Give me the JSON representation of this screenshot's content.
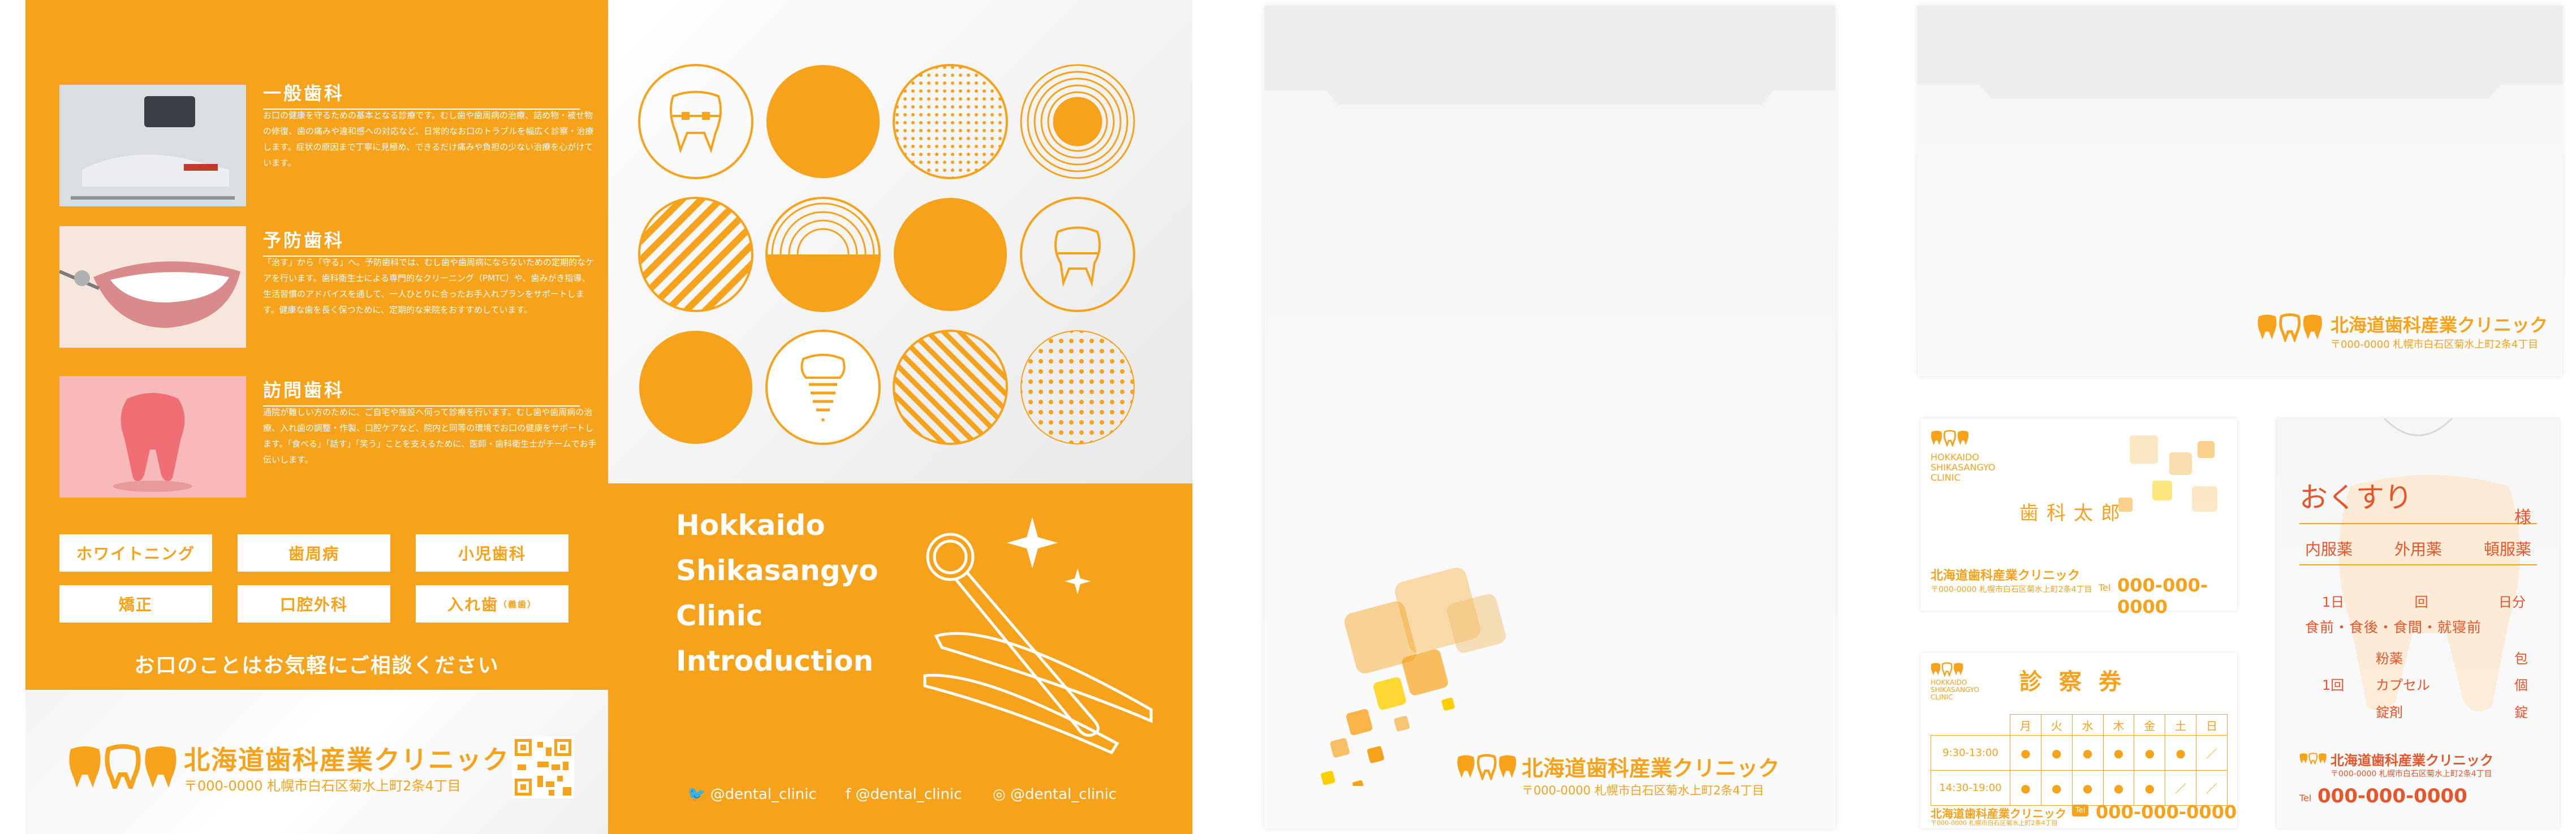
{
  "clinic": {
    "name_jp": "北海道歯科産業クリニック",
    "address": "〒000-0000 札幌市白石区菊水上町2条4丁目",
    "tel_label": "Tel",
    "tel": "000-000-0000"
  },
  "services": [
    {
      "title": "一般歯科",
      "text": "お口の健康を守るための基本となる診療です。むし歯や歯周病の治療、詰め物・被せ物の修復、歯の痛みや違和感への対応など、日常的なお口のトラブルを幅広く診察・治療します。症状の原因まで丁寧に見極め、できるだけ痛みや負担の少ない治療を心がけています。"
    },
    {
      "title": "予防歯科",
      "text": "「治す」から「守る」へ。予防歯科では、むし歯や歯周病にならないための定期的なケアを行います。歯科衛生士による専門的なクリーニング（PMTC）や、歯みがき指導、生活習慣のアドバイスを通して、一人ひとりに合ったお手入れプランをサポートします。健康な歯を長く保つために、定期的な来院をおすすめしています。"
    },
    {
      "title": "訪問歯科",
      "text": "通院が難しい方のために、ご自宅や施設へ伺って診療を行います。むし歯や歯周病の治療、入れ歯の調整・作製、口腔ケアなど、院内と同等の環境でお口の健康をサポートします。「食べる」「話す」「笑う」ことを支えるために、医師・歯科衛生士がチームでお手伝いします。"
    }
  ],
  "tags": [
    "ホワイトニング",
    "歯周病",
    "小児歯科",
    "矯正",
    "口腔外科",
    "入れ歯"
  ],
  "tag_note": "（義歯）",
  "consult_text": "お口のことはお気軽にご相談ください",
  "intro_lines": [
    "Hokkaido",
    "Shikasangyo",
    "Clinic",
    "Introduction"
  ],
  "social": [
    "@dental_clinic",
    "@dental_clinic",
    "@dental_clinic"
  ],
  "card": {
    "brand_en": [
      "HOKKAIDO",
      "SHIKASANGYO",
      "CLINIC"
    ],
    "person": "歯科太郎"
  },
  "ticket": {
    "title": "診察券",
    "days": [
      "月",
      "火",
      "水",
      "木",
      "金",
      "土",
      "日"
    ],
    "rows": [
      {
        "time": "9:30-13:00",
        "marks": [
          "●",
          "●",
          "●",
          "●",
          "●",
          "●",
          "／"
        ]
      },
      {
        "time": "14:30-19:00",
        "marks": [
          "●",
          "●",
          "●",
          "●",
          "●",
          "／",
          "／"
        ]
      }
    ]
  },
  "medicine": {
    "title": "おくすり",
    "honorific": "様",
    "types": [
      "内服薬",
      "外用薬",
      "頓服薬"
    ],
    "dose_row": [
      "1日",
      "回",
      "日分"
    ],
    "timing": "食前・食後・食間・就寝前",
    "forms": [
      {
        "form": "粉薬",
        "unit": "包"
      },
      {
        "form": "カプセル",
        "unit": "個"
      },
      {
        "form": "錠剤",
        "unit": "錠"
      }
    ],
    "times_label": "1回"
  },
  "colors": {
    "accent": "#f7a21b",
    "white": "#ffffff",
    "gray": "#f2f2f2"
  }
}
